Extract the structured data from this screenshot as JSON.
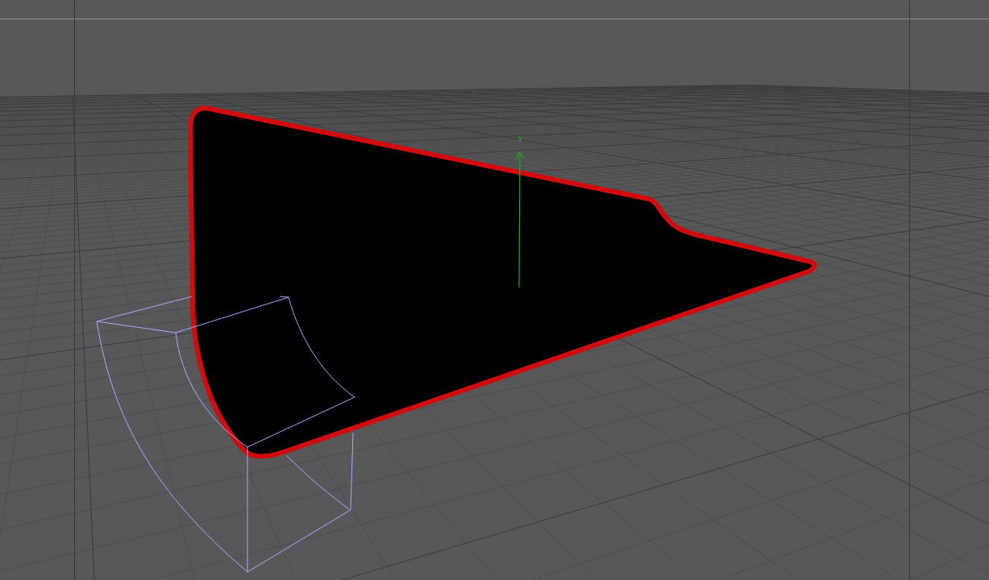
{
  "viewport": {
    "object": {
      "selected": true
    },
    "axis": {
      "label": "Y"
    }
  }
}
